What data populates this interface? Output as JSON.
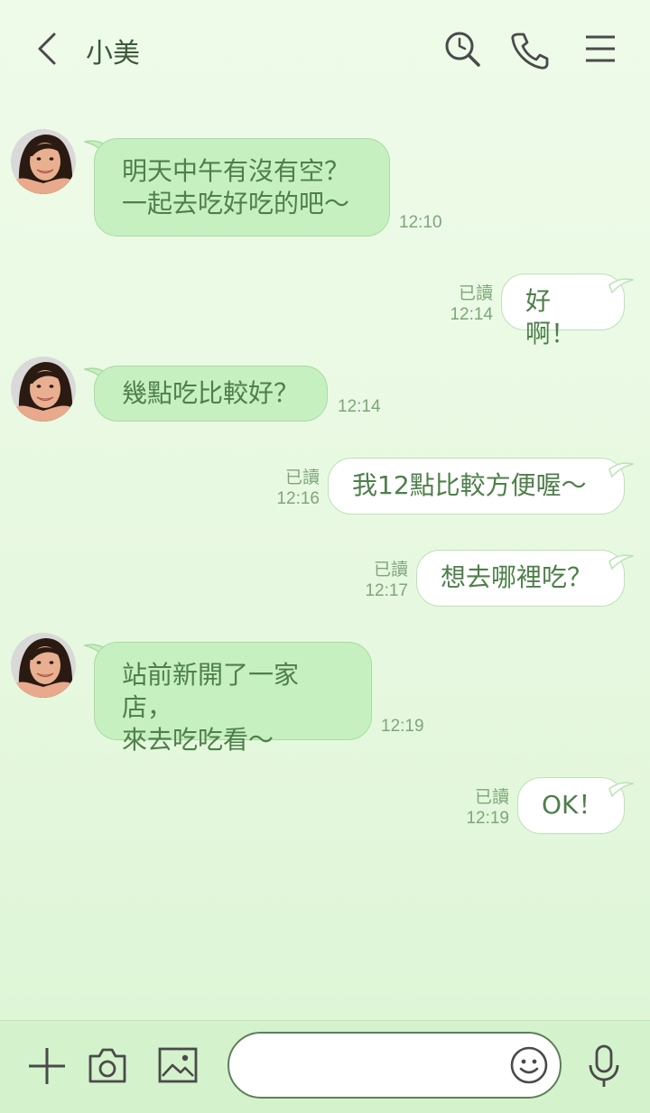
{
  "header": {
    "title": "小美"
  },
  "messages": [
    {
      "dir": "in",
      "lines": [
        "明天中午有沒有空？",
        "一起去吃好吃的吧～"
      ],
      "time": "12:10"
    },
    {
      "dir": "out",
      "text": "好啊！",
      "read": "已讀",
      "time": "12:14"
    },
    {
      "dir": "in",
      "lines": [
        "幾點吃比較好？"
      ],
      "time": "12:14"
    },
    {
      "dir": "out",
      "text": "我12點比較方便喔～",
      "read": "已讀",
      "time": "12:16"
    },
    {
      "dir": "out",
      "text": "想去哪裡吃？",
      "read": "已讀",
      "time": "12:17"
    },
    {
      "dir": "in",
      "lines": [
        "站前新開了一家店，",
        "來去吃吃看～"
      ],
      "time": "12:19"
    },
    {
      "dir": "out",
      "text": "OK！",
      "read": "已讀",
      "time": "12:19"
    }
  ],
  "composer": {
    "placeholder": ""
  },
  "icons": {
    "back": "chevron-left-icon",
    "search": "search-icon",
    "call": "phone-icon",
    "menu": "menu-icon",
    "add": "plus-icon",
    "camera": "camera-icon",
    "image": "image-icon",
    "emoji": "smiley-icon",
    "mic": "microphone-icon"
  },
  "colors": {
    "incoming_bubble": "#c7f0c1",
    "outgoing_bubble": "#ffffff",
    "text": "#4e7f4a",
    "meta": "#7ea67a"
  }
}
